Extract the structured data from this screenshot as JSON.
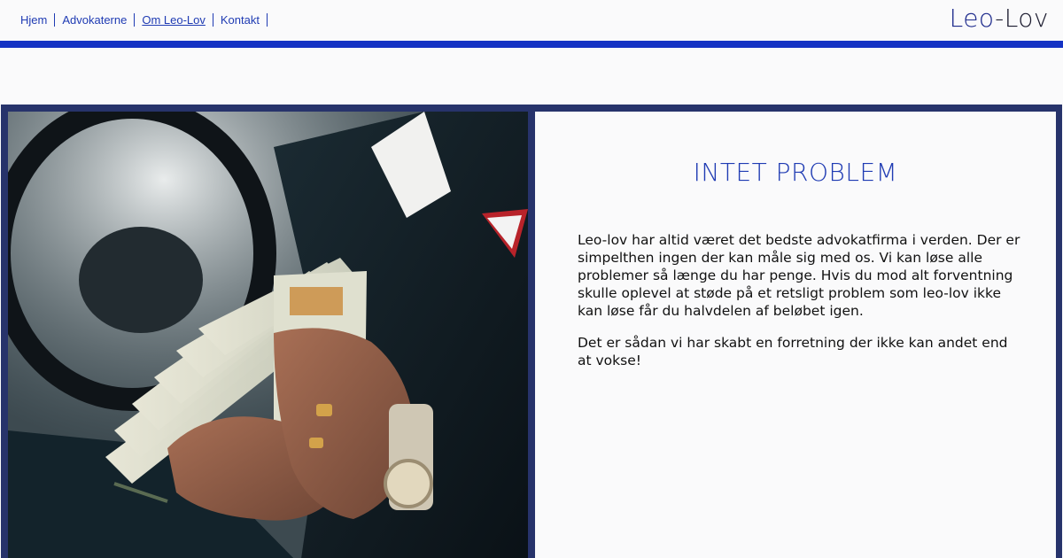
{
  "nav": {
    "items": [
      {
        "label": "Hjem"
      },
      {
        "label": "Advokaterne"
      },
      {
        "label": "Om Leo-Lov",
        "active": true
      },
      {
        "label": "Kontakt"
      }
    ]
  },
  "logo": {
    "part1": "Leo",
    "separator": "-",
    "part2": "Lov"
  },
  "colors": {
    "accent": "#1533c4",
    "frame": "#27336b",
    "headline": "#1f3bb3"
  },
  "hero": {
    "image_description_icon": "photo-money-watch-icon",
    "headline": "INTET PROBLEM",
    "paragraphs": [
      "Leo-lov har altid været det bedste advokatfirma i verden. Der er simpelthen ingen der kan måle sig med os. Vi kan løse alle problemer så længe du har penge. Hvis du mod alt forventning skulle oplevel at støde på et retsligt problem som leo-lov ikke kan løse får du halvdelen af beløbet igen.",
      "Det er sådan vi har skabt en forretning der ikke kan andet end at vokse!"
    ]
  }
}
